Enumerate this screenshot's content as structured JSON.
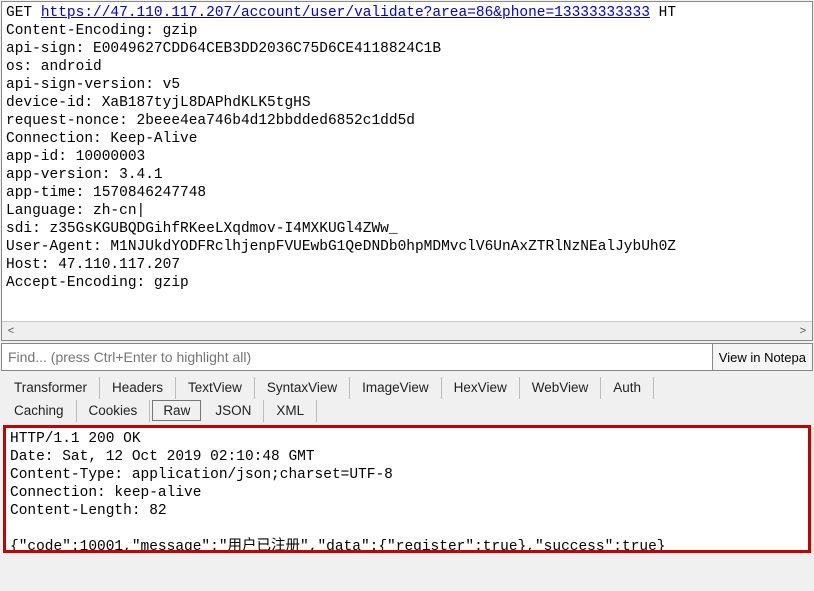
{
  "request": {
    "method": "GET",
    "url": "https://47.110.117.207/account/user/validate?area=86&phone=13333333333",
    "http_trail": " HT",
    "headers": [
      "Content-Encoding: gzip",
      "api-sign: E0049627CDD64CEB3DD2036C75D6CE4118824C1B",
      "os: android",
      "api-sign-version: v5",
      "device-id: XaB187tyjL8DAPhdKLK5tgHS",
      "request-nonce: 2beee4ea746b4d12bbdded6852c1dd5d",
      "Connection: Keep-Alive",
      "app-id: 10000003",
      "app-version: 3.4.1",
      "app-time: 1570846247748",
      "Language: zh-cn|",
      "sdi: z35GsKGUBQDGihfRKeeLXqdmov-I4MXKUGl4ZWw_",
      "User-Agent: M1NJUkdYODFRclhjenpFVUEwbG1QeDNDb0hpMDMvclV6UnAxZTRlNzNEalJybUh0Z",
      "Host: 47.110.117.207",
      "Accept-Encoding: gzip"
    ]
  },
  "scroll": {
    "left": "<",
    "right": ">"
  },
  "find": {
    "placeholder": "Find... (press Ctrl+Enter to highlight all)",
    "button": "View in Notepa"
  },
  "tabs_row1": {
    "transformer": "Transformer",
    "headers": "Headers",
    "textview": "TextView",
    "syntaxview": "SyntaxView",
    "imageview": "ImageView",
    "hexview": "HexView",
    "webview": "WebView",
    "auth": "Auth"
  },
  "tabs_row2": {
    "caching": "Caching",
    "cookies": "Cookies",
    "raw": "Raw",
    "json": "JSON",
    "xml": "XML"
  },
  "response": {
    "status_line": "HTTP/1.1 200 OK",
    "headers": [
      "Date: Sat, 12 Oct 2019 02:10:48 GMT",
      "Content-Type: application/json;charset=UTF-8",
      "Connection: keep-alive",
      "Content-Length: 82"
    ],
    "body": "{\"code\":10001,\"message\":\"用户已注册\",\"data\":{\"register\":true},\"success\":true}"
  }
}
